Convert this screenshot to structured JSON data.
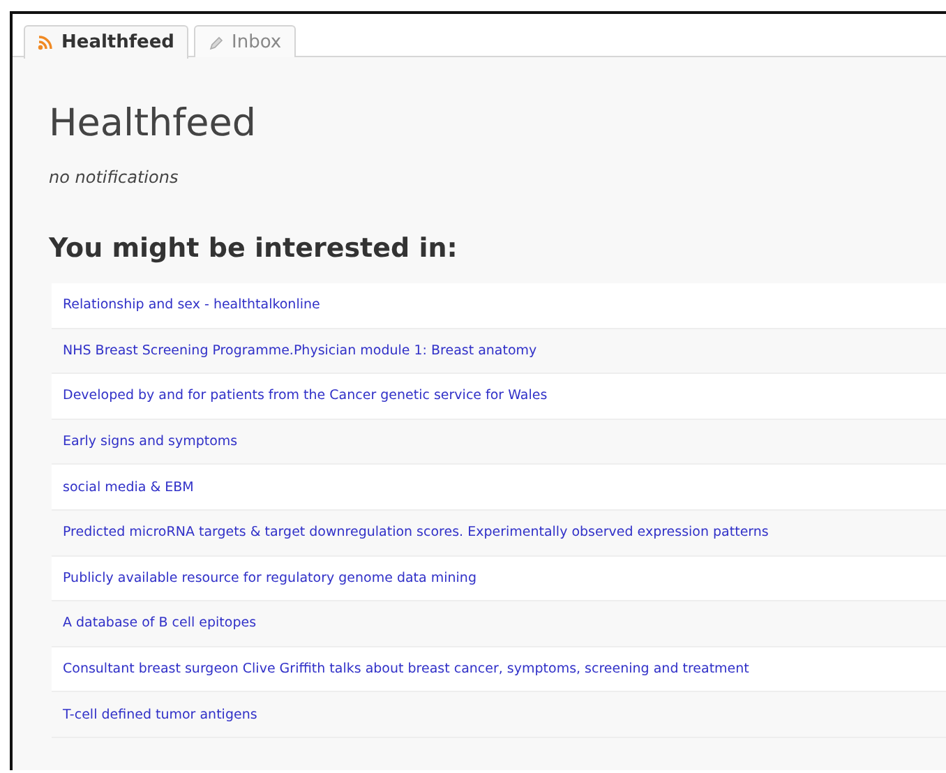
{
  "tabs": [
    {
      "label": "Healthfeed",
      "kind": "feed",
      "selected": true
    },
    {
      "label": "Inbox",
      "kind": "inbox",
      "selected": false
    }
  ],
  "title": "Healthfeed",
  "notice": "no notifications",
  "section_heading": "You might be interested in:",
  "links": [
    "Relationship and sex - healthtalkonline",
    "NHS Breast Screening Programme.Physician module 1: Breast anatomy",
    "Developed by and for patients from the Cancer genetic service for Wales",
    "Early signs and symptoms",
    "social media & EBM",
    "Predicted microRNA targets & target downregulation scores. Experimentally observed expression patterns",
    "Publicly available resource for regulatory genome data mining",
    "A database of B cell epitopes",
    "Consultant breast surgeon Clive Griffith talks about breast cancer, symptoms, screening and treatment",
    "T-cell defined tumor antigens"
  ]
}
